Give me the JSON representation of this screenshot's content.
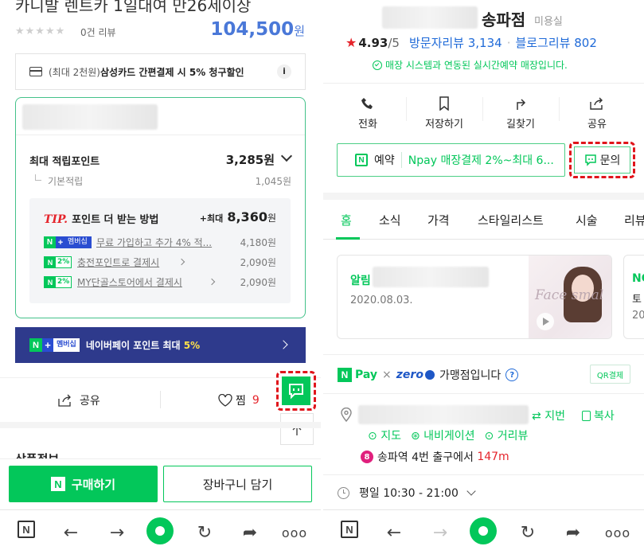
{
  "left": {
    "product_title": "카니발 렌트카 1일대여 만26세이상",
    "stars": "★★★★★",
    "review_count": "0건 리뷰",
    "price": "104,500",
    "price_unit": "원",
    "card_promo": {
      "prefix": "(최대 2천원)",
      "text": "삼성카드 간편결제 시 5% 청구할인",
      "info": "i"
    },
    "points": {
      "max_label": "최대 적립포인트",
      "max_value": "3,285원",
      "basic_label": "기본적립",
      "basic_value": "1,045원",
      "tip_label": "TIP.",
      "tip_text": "포인트 더 받는 방법",
      "tip_max_prefix": "+최대",
      "tip_max_value": "8,360",
      "tip_max_unit": "원",
      "rows": [
        {
          "badge": "멤버십",
          "text": "무료 가입하고 추가 4% 적...",
          "value": "4,180원"
        },
        {
          "badge": "2%",
          "text": "충전포인트로 결제시",
          "value": "2,090원"
        },
        {
          "badge": "2%",
          "text": "MY단골스토어에서 결제시",
          "value": "2,090원"
        }
      ]
    },
    "membership_banner": {
      "badge": "멤버십",
      "text": "네이버페이 포인트 최대 ",
      "highlight": "5%"
    },
    "share_label": "공유",
    "wish_label": "찜",
    "wish_count": "9",
    "section_partial": "상품정보",
    "buy_label": "구매하기",
    "cart_label": "장바구니 담기"
  },
  "right": {
    "shop_name": "송파점",
    "shop_category": "미용실",
    "rating": "4.93",
    "rating_max": "/5",
    "visitor_review": "방문자리뷰 3,134",
    "blog_review": "블로그리뷰 802",
    "realtime_notice": "매장 시스템과 연동된 실시간예약 매장입니다.",
    "actions": [
      {
        "label": "전화",
        "icon": "phone-icon"
      },
      {
        "label": "저장하기",
        "icon": "bookmark-icon"
      },
      {
        "label": "길찾기",
        "icon": "directions-icon"
      },
      {
        "label": "공유",
        "icon": "share-icon"
      }
    ],
    "reserve_label": "예약",
    "npay_text": "Npay 매장결제 2%~최대 6...",
    "inquiry_label": "문의",
    "tabs": [
      "홈",
      "소식",
      "가격",
      "스타일리스트",
      "시술",
      "리뷰"
    ],
    "notice_card": {
      "tag": "알림",
      "date": "2020.08.03.",
      "thumb_text": "Face smal"
    },
    "partial_card": {
      "tag": "NC",
      "line2": "토",
      "line3": "20"
    },
    "pay_label": "Pay",
    "zero_label": "zero",
    "pay_text": "가맹점입니다",
    "qr_label": "QR결제",
    "subway_label": "지번",
    "copy_label": "복사",
    "map_label": "지도",
    "navi_label": "내비게이션",
    "street_label": "거리뷰",
    "station_line": "8",
    "station_text": "송파역 4번 출구에서 ",
    "station_dist": "147m",
    "hours": "평일 10:30 - 21:00"
  },
  "colors": {
    "naver_green": "#03c75a",
    "price_blue": "#4a78d8",
    "link_blue": "#1f6ad8",
    "dash_red": "#e0151b",
    "banner_navy": "#2e3a8c"
  }
}
